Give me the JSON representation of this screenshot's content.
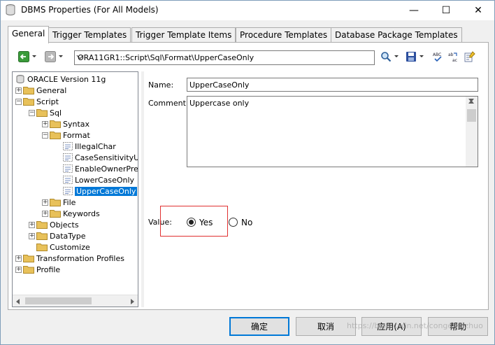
{
  "window": {
    "title": "DBMS Properties (For All Models)",
    "controls": {
      "minimize": "—",
      "maximize": "☐",
      "close": "✕"
    }
  },
  "tabs": [
    {
      "label": "General",
      "active": true
    },
    {
      "label": "Trigger Templates"
    },
    {
      "label": "Trigger Template Items"
    },
    {
      "label": "Procedure Templates"
    },
    {
      "label": "Database Package Templates"
    }
  ],
  "toolbar": {
    "path": "ORA11GR1::Script\\Sql\\Format\\UpperCaseOnly",
    "icons": [
      "back-icon",
      "forward-icon",
      "find-icon",
      "save-icon",
      "spell-check-icon",
      "replace-icon",
      "properties-icon"
    ]
  },
  "tree": {
    "root": "ORACLE Version 11g",
    "items": [
      {
        "label": "General",
        "level": 1,
        "expander": "+",
        "kind": "folder"
      },
      {
        "label": "Script",
        "level": 1,
        "expander": "−",
        "kind": "folder"
      },
      {
        "label": "Sql",
        "level": 2,
        "expander": "−",
        "kind": "folder"
      },
      {
        "label": "Syntax",
        "level": 3,
        "expander": "+",
        "kind": "folder"
      },
      {
        "label": "Format",
        "level": 3,
        "expander": "−",
        "kind": "folder"
      },
      {
        "label": "IllegalChar",
        "level": 4,
        "kind": "doc"
      },
      {
        "label": "CaseSensitivityUs",
        "level": 4,
        "kind": "doc"
      },
      {
        "label": "EnableOwnerPre",
        "level": 4,
        "kind": "doc"
      },
      {
        "label": "LowerCaseOnly",
        "level": 4,
        "kind": "doc"
      },
      {
        "label": "UpperCaseOnly",
        "level": 4,
        "kind": "doc",
        "selected": true
      },
      {
        "label": "File",
        "level": 3,
        "expander": "+",
        "kind": "folder"
      },
      {
        "label": "Keywords",
        "level": 3,
        "expander": "+",
        "kind": "folder"
      },
      {
        "label": "Objects",
        "level": 2,
        "expander": "+",
        "kind": "folder"
      },
      {
        "label": "DataType",
        "level": 2,
        "expander": "+",
        "kind": "folder"
      },
      {
        "label": "Customize",
        "level": 2,
        "kind": "folder"
      },
      {
        "label": "Transformation Profiles",
        "level": 1,
        "expander": "+",
        "kind": "folder"
      },
      {
        "label": "Profile",
        "level": 1,
        "expander": "+",
        "kind": "folder"
      }
    ]
  },
  "detail": {
    "name_label": "Name:",
    "name_value": "UpperCaseOnly",
    "comment_label": "Comment:",
    "comment_value": "Uppercase only",
    "value_label": "Value:",
    "options": [
      {
        "label": "Yes",
        "checked": true
      },
      {
        "label": "No",
        "checked": false
      }
    ]
  },
  "footer": {
    "ok": "确定",
    "cancel": "取消",
    "apply": "应用(A)",
    "help": "帮助"
  },
  "watermark": "https://blog.csdn.net/congdingzhuo",
  "colors": {
    "selection": "#0078d7",
    "highlight_box": "#e03030",
    "folder": "#e8c15a"
  }
}
